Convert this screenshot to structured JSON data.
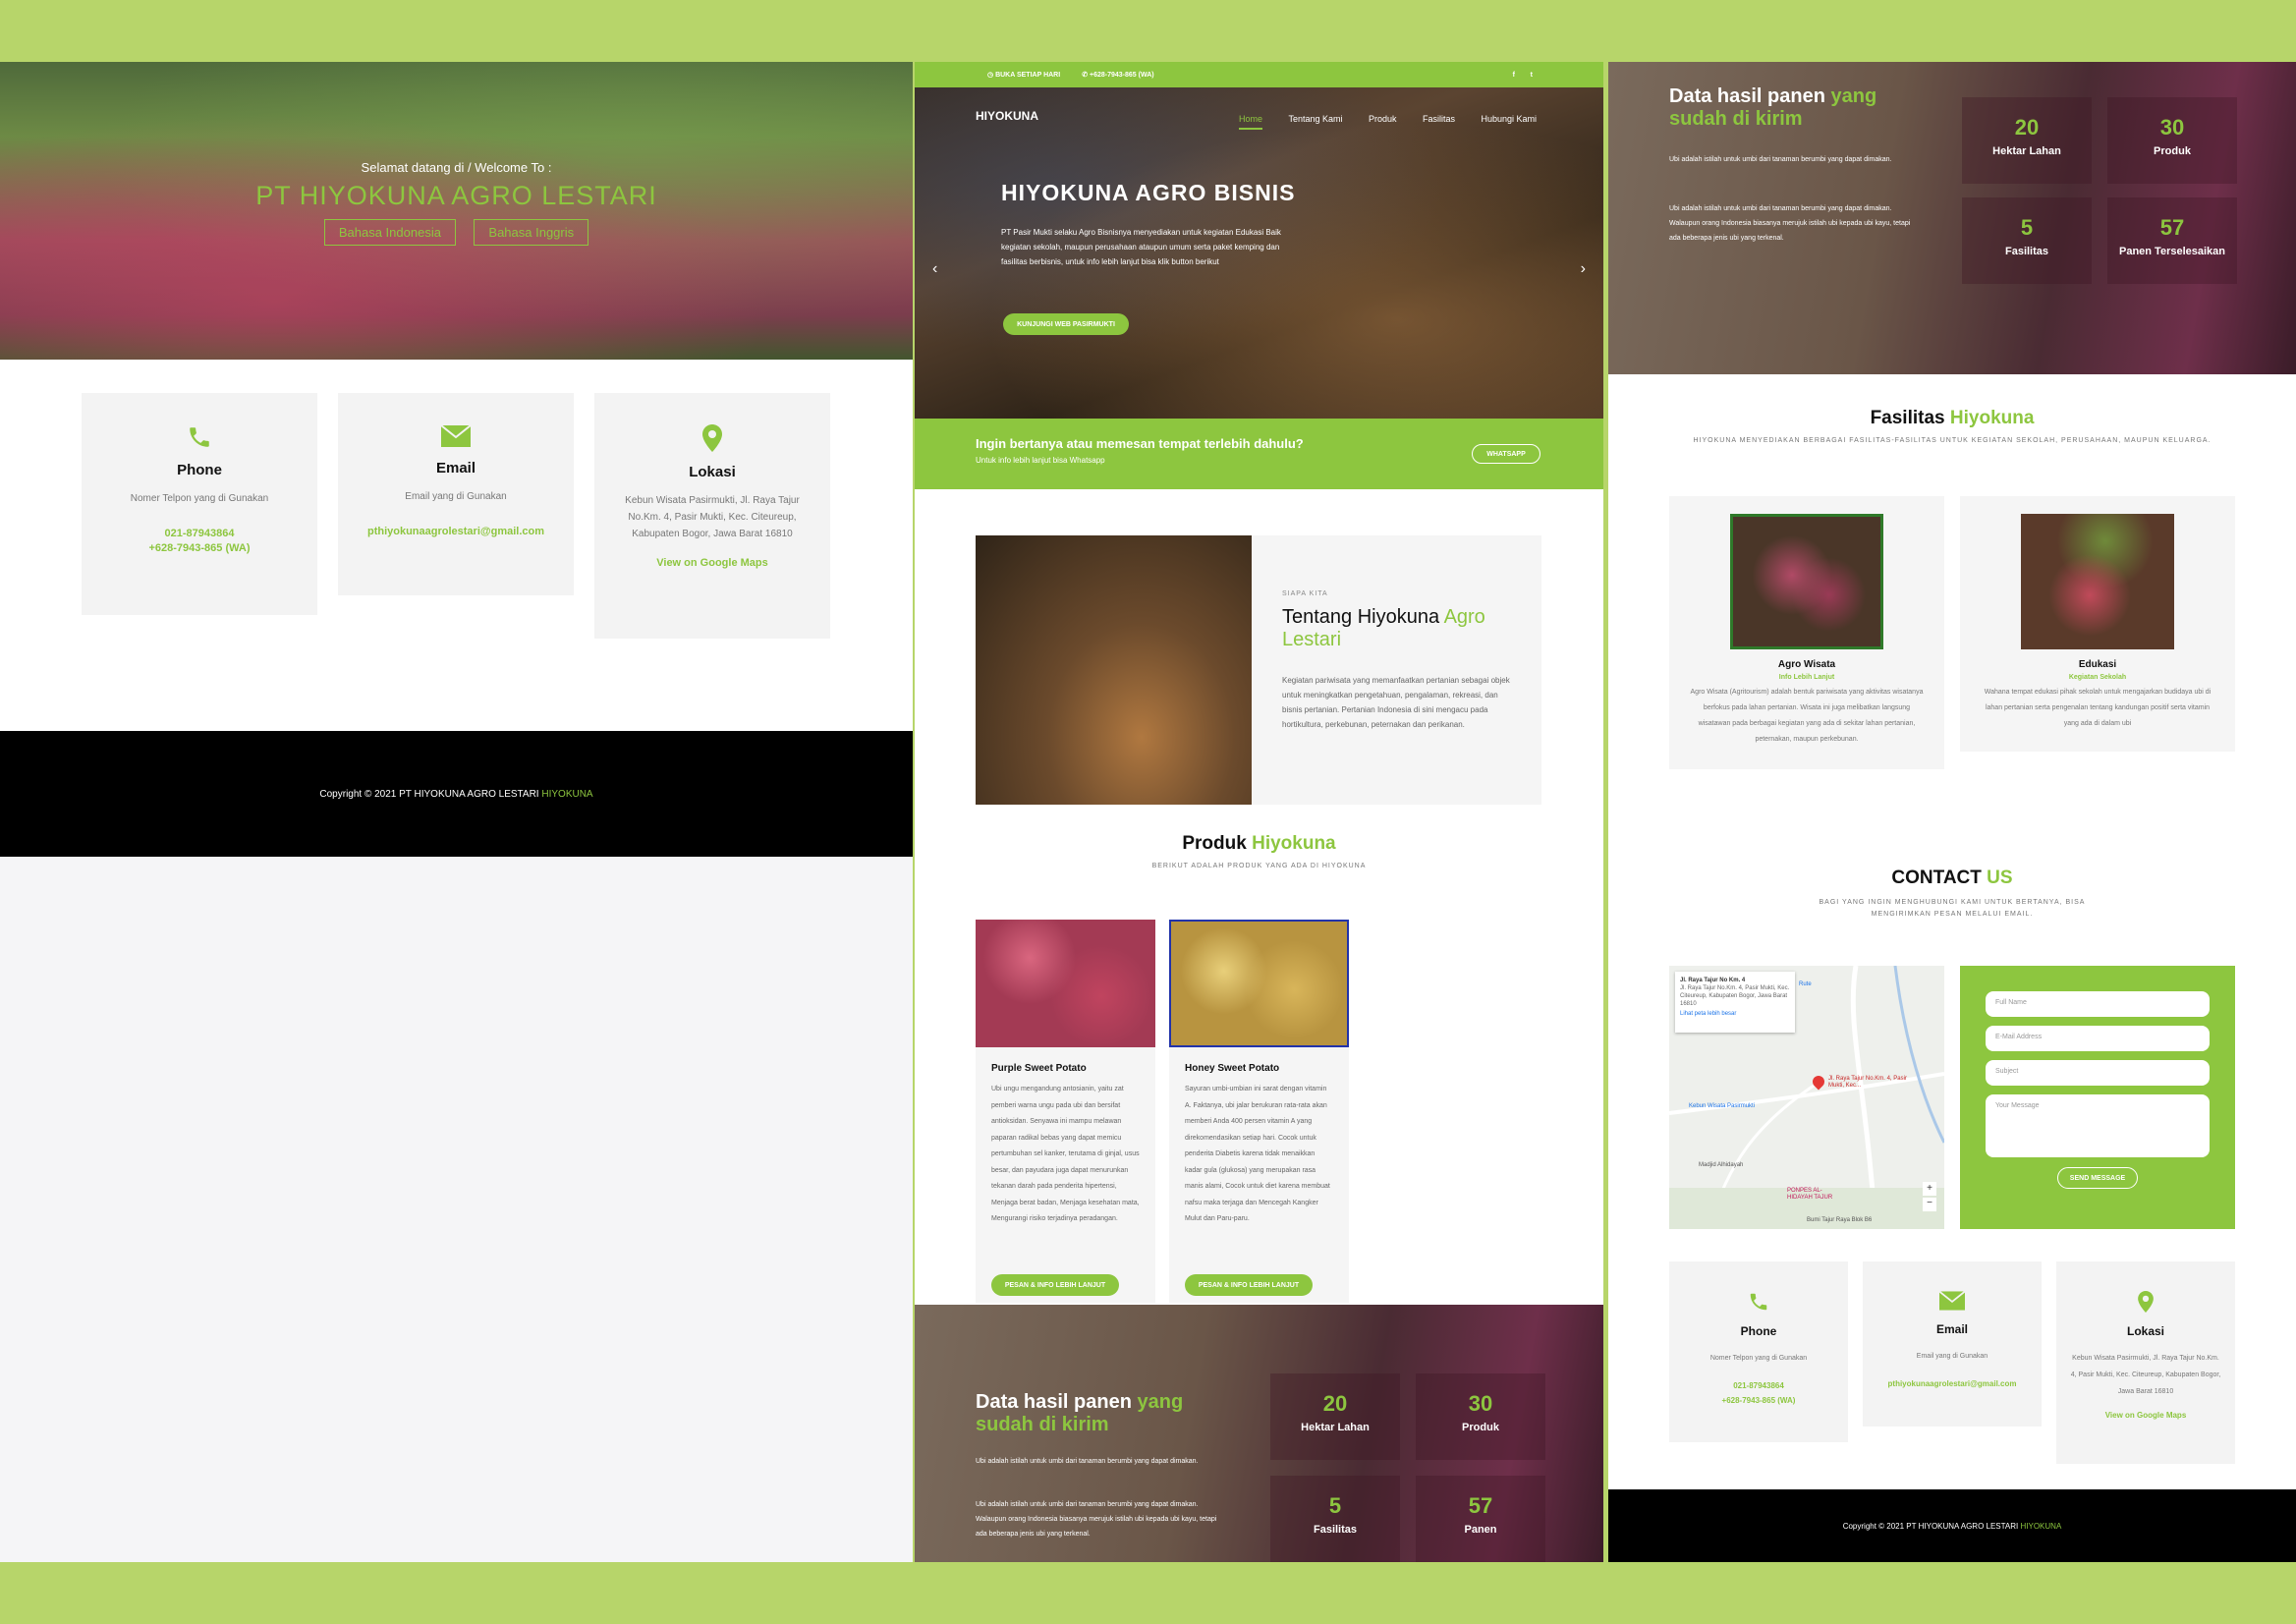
{
  "panel1": {
    "hero": {
      "welcome": "Selamat datang di / Welcome To :",
      "title": "PT HIYOKUNA AGRO LESTARI",
      "buttons": [
        "Bahasa Indonesia",
        "Bahasa Inggris"
      ]
    },
    "contact_cards": [
      {
        "icon": "phone-icon",
        "title": "Phone",
        "subtitle": "Nomer Telpon yang di Gunakan",
        "lines": [
          "021-87943864",
          "+628-7943-865 (WA)"
        ]
      },
      {
        "icon": "envelope-icon",
        "title": "Email",
        "subtitle": "Email yang di Gunakan",
        "lines": [
          "pthiyokunaagrolestari@gmail.com"
        ]
      },
      {
        "icon": "map-pin-icon",
        "title": "Lokasi",
        "subtitle": "Kebun Wisata Pasirmukti, Jl. Raya Tajur No.Km. 4, Pasir Mukti, Kec. Citeureup, Kabupaten Bogor, Jawa Barat 16810",
        "lines": [
          "View on Google Maps"
        ]
      }
    ],
    "footer": {
      "text": "Copyright © 2021 PT HIYOKUNA AGRO LESTARI",
      "brand": "HIYOKUNA"
    }
  },
  "panel2": {
    "topbar": {
      "hours": "BUKA SETIAP HARI",
      "phone": "+628-7943-865 (WA)"
    },
    "brand": "HIYOKUNA",
    "nav": [
      "Home",
      "Tentang Kami",
      "Produk",
      "Fasilitas",
      "Hubungi Kami"
    ],
    "hero": {
      "title": "HIYOKUNA AGRO BISNIS",
      "text": "PT Pasir Mukti selaku Agro Bisnisnya menyediakan untuk kegiatan Edukasi Baik kegiatan sekolah, maupun perusahaan ataupun umum serta paket kemping dan fasilitas berbisnis, untuk info lebih lanjut bisa klik button berikut",
      "button": "KUNJUNGI WEB PASIRMUKTI"
    },
    "cta": {
      "title": "Ingin bertanya atau memesan tempat terlebih dahulu?",
      "sub": "Untuk info lebih lanjut bisa Whatsapp",
      "button": "WHATSAPP"
    },
    "about": {
      "kicker": "SIAPA KITA",
      "title_a": "Tentang Hiyokuna",
      "title_b": "Agro Lestari",
      "text": "Kegiatan pariwisata yang memanfaatkan pertanian sebagai objek untuk meningkatkan pengetahuan, pengalaman, rekreasi, dan bisnis pertanian. Pertanian Indonesia di sini mengacu pada hortikultura, perkebunan, peternakan dan perikanan."
    },
    "products_header": {
      "title_a": "Produk",
      "title_b": "Hiyokuna",
      "sub": "BERIKUT ADALAH PRODUK YANG ADA DI HIYOKUNA"
    },
    "products": [
      {
        "name": "Purple Sweet Potato",
        "text": "Ubi ungu mengandung antosianin, yaitu zat pemberi warna ungu pada ubi dan bersifat antioksidan. Senyawa ini mampu melawan paparan radikal bebas yang dapat memicu pertumbuhan sel kanker, terutama di ginjal, usus besar, dan payudara juga dapat menurunkan tekanan darah pada penderita hipertensi, Menjaga berat badan, Menjaga kesehatan mata, Mengurangi risiko terjadinya peradangan.",
        "button": "PESAN & INFO LEBIH LANJUT"
      },
      {
        "name": "Honey Sweet Potato",
        "text": "Sayuran umbi-umbian ini sarat dengan vitamin A. Faktanya, ubi jalar berukuran rata-rata akan memberi Anda 400 persen vitamin A yang direkomendasikan setiap hari. Cocok untuk penderita Diabetis karena tidak menaikkan kadar gula (glukosa) yang merupakan rasa manis alami, Cocok untuk diet karena membuat nafsu maka terjaga dan Mencegah Kangker Mulut dan Paru-paru.",
        "button": "PESAN & INFO LEBIH LANJUT"
      }
    ],
    "stats_title_a": "Data hasil panen",
    "stats_title_b": "yang sudah di kirim",
    "stats_text1": "Ubi adalah istilah untuk umbi dari tanaman berumbi yang dapat dimakan.",
    "stats_text2": "Ubi adalah istilah untuk umbi dari tanaman berumbi yang dapat dimakan. Walaupun orang Indonesia biasanya merujuk istilah ubi kepada ubi kayu, tetapi ada beberapa jenis ubi yang terkenal.",
    "stats": [
      {
        "n": "20",
        "l": "Hektar Lahan"
      },
      {
        "n": "30",
        "l": "Produk"
      },
      {
        "n": "5",
        "l": "Fasilitas"
      },
      {
        "n": "57",
        "l": "Panen"
      }
    ]
  },
  "panel3": {
    "stats_title_a": "Data hasil panen",
    "stats_title_b": "yang sudah di kirim",
    "stats_text1": "Ubi adalah istilah untuk umbi dari tanaman berumbi yang dapat dimakan.",
    "stats_text2": "Ubi adalah istilah untuk umbi dari tanaman berumbi yang dapat dimakan. Walaupun orang Indonesia biasanya merujuk istilah ubi kepada ubi kayu, tetapi ada beberapa jenis ubi yang terkenal.",
    "stats": [
      {
        "n": "20",
        "l": "Hektar Lahan"
      },
      {
        "n": "30",
        "l": "Produk"
      },
      {
        "n": "5",
        "l": "Fasilitas"
      },
      {
        "n": "57",
        "l": "Panen Terselesaikan"
      }
    ],
    "facilities_header": {
      "title_a": "Fasilitas",
      "title_b": "Hiyokuna",
      "sub": "HIYOKUNA MENYEDIAKAN BERBAGAI FASILITAS-FASILITAS UNTUK KEGIATAN SEKOLAH, PERUSAHAAN, MAUPUN KELUARGA."
    },
    "facilities": [
      {
        "name": "Agro Wisata",
        "link": "Info Lebih Lanjut",
        "text": "Agro Wisata (Agritourism) adalah bentuk pariwisata yang aktivitas wisatanya berfokus pada lahan pertanian. Wisata ini juga melibatkan langsung wisatawan pada berbagai kegiatan yang ada di sekitar lahan pertanian, peternakan, maupun perkebunan."
      },
      {
        "name": "Edukasi",
        "link": "Kegiatan Sekolah",
        "text": "Wahana tempat edukasi pihak sekolah untuk mengajarkan budidaya ubi di lahan pertanian serta pengenalan tentang kandungan positif serta vitamin yang ada di dalam ubi"
      }
    ],
    "contact_header": {
      "title_a": "CONTACT",
      "title_b": "US",
      "sub": "BAGI YANG INGIN MENGHUBUNGI KAMI UNTUK BERTANYA, BISA MENGIRIMKAN PESAN MELALUI EMAIL."
    },
    "map": {
      "place": "Jl. Raya Tajur No Km. 4",
      "address": "Jl. Raya Tajur No.Km. 4, Pasir Mukti, Kec. Citeureup, Kabupaten Bogor, Jawa Barat 16810",
      "view_larger": "Lihat peta lebih besar",
      "route": "Rute",
      "pin_label": "Jl. Raya Tajur No.Km. 4, Pasir Mukti, Kec...",
      "labels": [
        "Kebun Wisata Pasirmukti",
        "Madjid Alhidayah",
        "PONPES AL-HIDAYAH TAJUR",
        "Bumi Tajur Raya Blok B6"
      ]
    },
    "form": {
      "name": "Full Name",
      "email": "E-Mail Address",
      "subject": "Subject",
      "message": "Your Message",
      "button": "SEND MESSAGE"
    },
    "contact_cards": [
      {
        "icon": "phone-icon",
        "title": "Phone",
        "subtitle": "Nomer Telpon yang di Gunakan",
        "lines": [
          "021-87943864",
          "+628-7943-865 (WA)"
        ]
      },
      {
        "icon": "envelope-icon",
        "title": "Email",
        "subtitle": "Email yang di Gunakan",
        "lines": [
          "pthiyokunaagrolestari@gmail.com"
        ]
      },
      {
        "icon": "map-pin-icon",
        "title": "Lokasi",
        "subtitle": "Kebun Wisata Pasirmukti, Jl. Raya Tajur No.Km. 4, Pasir Mukti, Kec. Citeureup, Kabupaten Bogor, Jawa Barat 16810",
        "lines": [
          "View on Google Maps"
        ]
      }
    ],
    "footer": {
      "text": "Copyright © 2021 PT HIYOKUNA AGRO LESTARI",
      "brand": "HIYOKUNA"
    }
  },
  "colors": {
    "accent": "#8dc63f",
    "background": "#b7d56a",
    "footer": "#000000"
  }
}
